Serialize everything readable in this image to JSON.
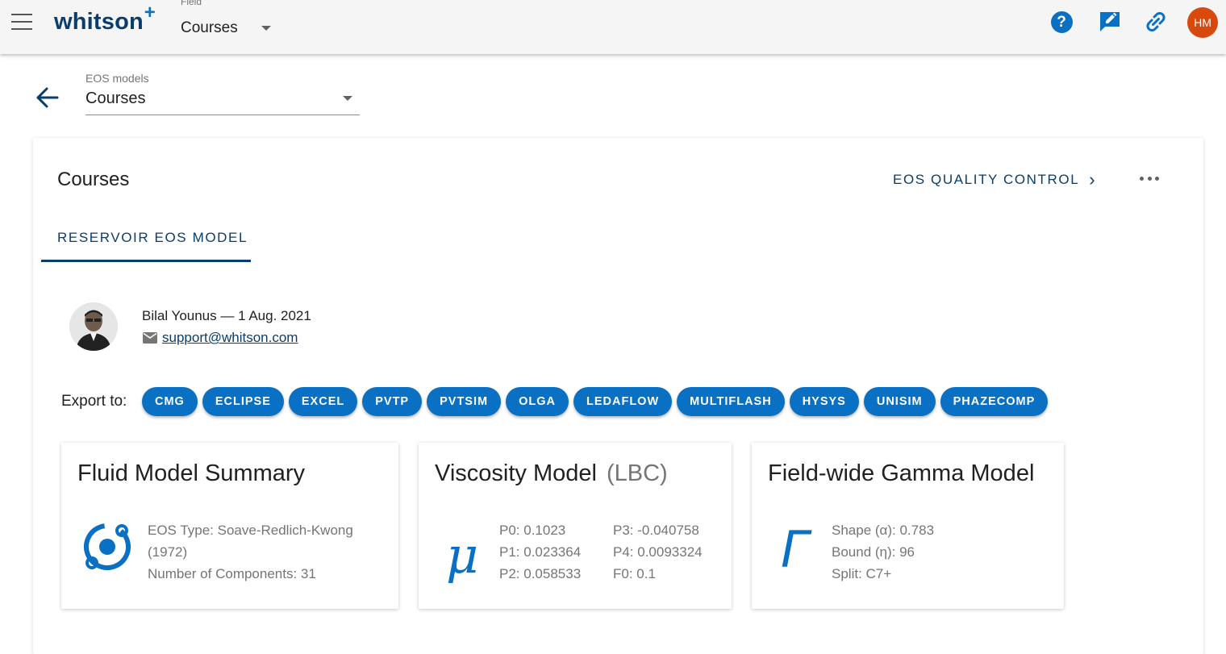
{
  "appbar": {
    "logo_text": "whitson",
    "logo_plus": "+",
    "field_label": "Field",
    "field_value": "Courses",
    "icons": [
      "help-icon",
      "feedback-icon",
      "link-icon"
    ],
    "help_glyph": "?",
    "user_initials": "HM",
    "accent_color": "#0a70c4",
    "avatar_color": "#d84a0c"
  },
  "subheader": {
    "eos_label": "EOS models",
    "eos_value": "Courses"
  },
  "card": {
    "title": "Courses",
    "qc_link": "EOS QUALITY CONTROL",
    "tab_label": "RESERVOIR EOS MODEL",
    "author_line": "Bilal Younus — 1 Aug. 2021",
    "email": "support@whitson.com",
    "export_label": "Export to:",
    "export_targets": [
      "CMG",
      "ECLIPSE",
      "EXCEL",
      "PVTP",
      "PVTSIM",
      "OLGA",
      "LEDAFLOW",
      "MULTIFLASH",
      "HYSYS",
      "UNISIM",
      "PHAZECOMP"
    ]
  },
  "fluid_summary": {
    "title": "Fluid Model Summary",
    "eos_type_line1": "EOS Type: Soave-Redlich-Kwong",
    "eos_type_line2": "(1972)",
    "components": "Number of Components: 31"
  },
  "viscosity": {
    "title": "Viscosity Model",
    "subtitle": "(LBC)",
    "glyph": "μ",
    "params_left": [
      "P0: 0.1023",
      "P1: 0.023364",
      "P2: 0.058533"
    ],
    "params_right": [
      "P3: -0.040758",
      "P4: 0.0093324",
      "F0: 0.1"
    ]
  },
  "gamma": {
    "title": "Field-wide Gamma Model",
    "glyph": "Γ",
    "shape": "Shape (α): 0.783",
    "bound": "Bound (η): 96",
    "split": "Split: C7+"
  }
}
